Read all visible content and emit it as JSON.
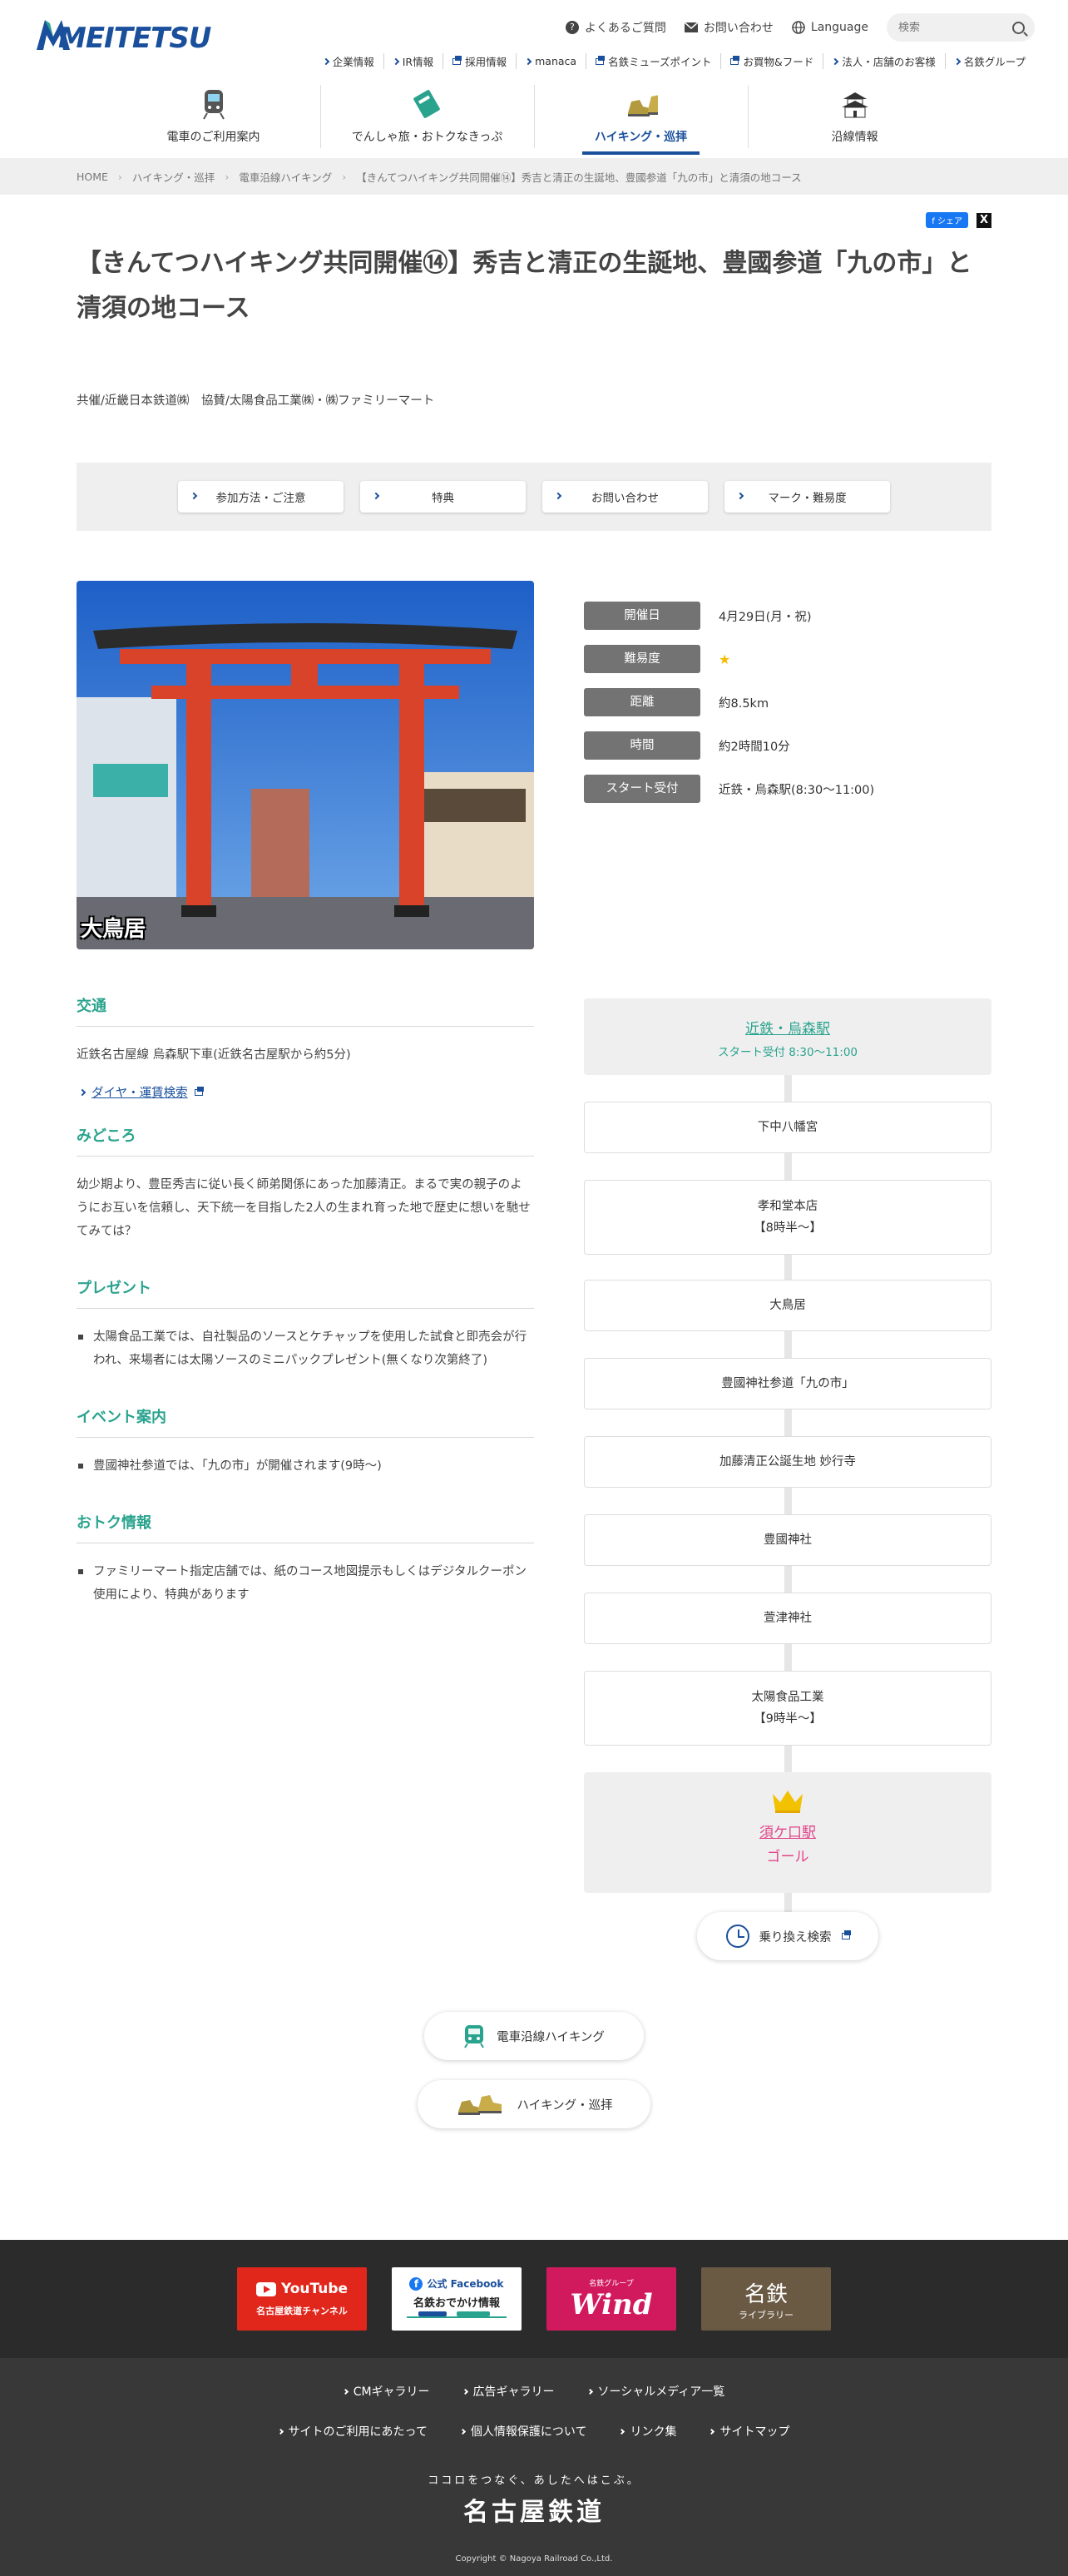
{
  "header": {
    "logo_text": "MEITETSU",
    "utility": {
      "faq": "よくあるご質問",
      "contact": "お問い合わせ",
      "language": "Language",
      "search_placeholder": "検索"
    },
    "sublinks": [
      "企業情報",
      "IR情報",
      "採用情報",
      "manaca",
      "名鉄ミューズポイント",
      "お買物&フード",
      "法人・店舗のお客様",
      "名鉄グループ"
    ],
    "gnav": [
      "電車のご利用案内",
      "でんしゃ旅・おトクなきっぷ",
      "ハイキング・巡拝",
      "沿線情報"
    ]
  },
  "breadcrumb": [
    "HOME",
    "ハイキング・巡拝",
    "電車沿線ハイキング",
    "【きんてつハイキング共同開催⑭】秀吉と清正の生誕地、豊國参道「九の市」と清須の地コース"
  ],
  "share": {
    "facebook": "シェア",
    "x": "X"
  },
  "page": {
    "title": "【きんてつハイキング共同開催⑭】秀吉と清正の生誕地、豊國参道「九の市」と清須の地コース",
    "sponsor": "共催/近畿日本鉄道㈱　協賛/太陽食品工業㈱・㈱ファミリーマート",
    "anchors": [
      "参加方法・ご注意",
      "特典",
      "お問い合わせ",
      "マーク・難易度"
    ]
  },
  "photo": {
    "caption": "大鳥居"
  },
  "info": [
    {
      "label": "開催日",
      "value": "4月29日(月・祝)"
    },
    {
      "label": "難易度",
      "value": "★",
      "difficulty_stars": 1
    },
    {
      "label": "距離",
      "value": "約8.5km"
    },
    {
      "label": "時間",
      "value": "約2時間10分"
    },
    {
      "label": "スタート受付",
      "value": "近鉄・烏森駅(8:30〜11:00)"
    }
  ],
  "sections": {
    "access": {
      "heading": "交通",
      "text": "近鉄名古屋線 烏森駅下車(近鉄名古屋駅から約5分)",
      "link": "ダイヤ・運賃検索"
    },
    "highlights": {
      "heading": "みどころ",
      "text": "幼少期より、豊臣秀吉に従い長く師弟関係にあった加藤清正。まるで実の親子のようにお互いを信頼し、天下統一を目指した2人の生まれ育った地で歴史に想いを馳せてみては？"
    },
    "present": {
      "heading": "プレゼント",
      "text": "太陽食品工業では、自社製品のソースとケチャップを使用した試食と即売会が行われ、来場者には太陽ソースのミニパックプレゼント(無くなり次第終了)"
    },
    "event": {
      "heading": "イベント案内",
      "text": "豊國神社参道では、「九の市」が開催されます(9時〜)"
    },
    "deal": {
      "heading": "おトク情報",
      "text": "ファミリーマート指定店舗では、紙のコース地図提示もしくはデジタルクーポン使用により、特典があります"
    }
  },
  "route": {
    "start": {
      "name": "近鉄・烏森駅",
      "note": "スタート受付 8:30〜11:00"
    },
    "points": [
      {
        "name": "下中八幡宮",
        "sub": ""
      },
      {
        "name": "孝和堂本店",
        "sub": "【8時半〜】"
      },
      {
        "name": "大鳥居",
        "sub": ""
      },
      {
        "name": "豊國神社参道「九の市」",
        "sub": ""
      },
      {
        "name": "加藤清正公誕生地 妙行寺",
        "sub": ""
      },
      {
        "name": "豊國神社",
        "sub": ""
      },
      {
        "name": "萱津神社",
        "sub": ""
      },
      {
        "name": "太陽食品工業",
        "sub": "【9時半〜】"
      }
    ],
    "goal": {
      "name": "須ケ口駅",
      "label": "ゴール"
    },
    "transfer": "乗り換え検索"
  },
  "bottom_links": [
    "電車沿線ハイキング",
    "ハイキング・巡拝"
  ],
  "footer": {
    "banners": {
      "youtube_main": "YouTube",
      "youtube_sub": "名古屋鉄道チャンネル",
      "facebook_main": "公式 Facebook",
      "facebook_sub": "名鉄おでかけ情報",
      "wind": "Wind",
      "wind_top": "名鉄グループ",
      "library": "名鉄",
      "library_sub": "ライブラリー"
    },
    "nav1": [
      "CMギャラリー",
      "広告ギャラリー",
      "ソーシャルメディア一覧"
    ],
    "nav2": [
      "サイトのご利用にあたって",
      "個人情報保護について",
      "リンク集",
      "サイトマップ"
    ],
    "tagline": "ココロをつなぐ、あしたへはこぶ。",
    "corp": "名古屋鉄道",
    "copyright": "Copyright © Nagoya Railroad Co.,Ltd."
  },
  "colors": {
    "brand_blue": "#1a4f9c",
    "section_green": "#2aa38e",
    "goal_pink": "#e0458a",
    "star": "#f2bd00"
  }
}
